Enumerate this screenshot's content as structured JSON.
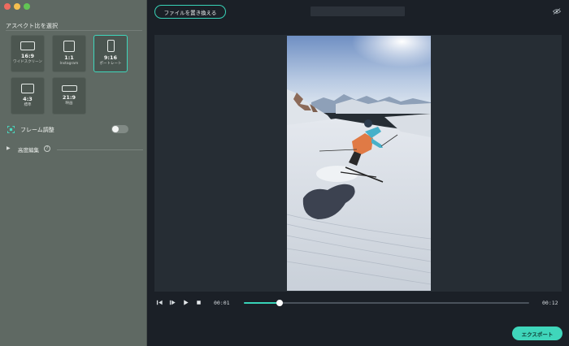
{
  "sidebar": {
    "section_title": "アスペクト比を選択",
    "ratios": [
      {
        "title": "16:9",
        "subtitle": "ワイドスクリーン",
        "icon": "landscape-wide-icon",
        "selected": false
      },
      {
        "title": "1:1",
        "subtitle": "Instagram",
        "icon": "square-icon",
        "selected": false
      },
      {
        "title": "9:16",
        "subtitle": "ポートレート",
        "icon": "portrait-icon",
        "selected": true
      },
      {
        "title": "4:3",
        "subtitle": "標準",
        "icon": "standard-icon",
        "selected": false
      },
      {
        "title": "21:9",
        "subtitle": "映画",
        "icon": "cinema-icon",
        "selected": false
      }
    ],
    "frame_adjust": {
      "label": "フレーム調整",
      "enabled": false,
      "icon": "frame-adjust-icon"
    },
    "advanced": {
      "label": "高度編集",
      "help_icon": "?",
      "expanded": false
    }
  },
  "toolbar": {
    "replace_file_label": "ファイルを置き換える",
    "eye_icon": "eye-hidden-icon"
  },
  "player": {
    "current_time": "00:01",
    "total_time": "00:12",
    "progress": 0.125
  },
  "export_label": "エクスポート",
  "colors": {
    "accent": "#3fd6bb",
    "sidebar_bg": "#5f6963",
    "main_bg": "#1b2027",
    "stage_bg": "#262d34"
  }
}
